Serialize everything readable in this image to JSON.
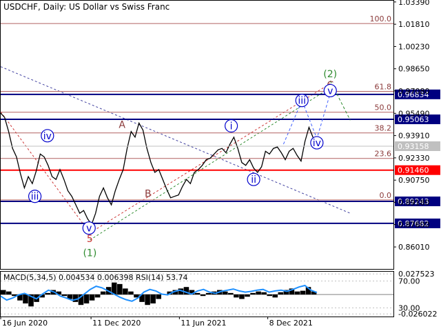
{
  "header": {
    "symbol": "USDCHF, Daily:",
    "description": "US Dollar vs Swiss Franc"
  },
  "chart_data": {
    "type": "line",
    "main": {
      "ylim": [
        0.8445,
        1.0348
      ],
      "y_ticks": [
        "1.03390",
        "1.01810",
        "1.00230",
        "0.98650",
        "0.97080",
        "0.95490",
        "0.93910",
        "0.92330",
        "0.90750",
        "0.89180",
        "0.87600",
        "0.86010"
      ],
      "x_ticks": [
        "16 Jun 2020",
        "11 Dec 2020",
        "11 Jun 2021",
        "8 Dec 2021"
      ],
      "price_label": "0.93158",
      "price_close": 0.93158,
      "price_series": [
        0.955,
        0.952,
        0.942,
        0.93,
        0.924,
        0.912,
        0.902,
        0.91,
        0.905,
        0.914,
        0.926,
        0.924,
        0.918,
        0.91,
        0.908,
        0.915,
        0.908,
        0.9,
        0.896,
        0.89,
        0.884,
        0.886,
        0.88,
        0.876,
        0.884,
        0.896,
        0.902,
        0.895,
        0.89,
        0.9,
        0.908,
        0.915,
        0.93,
        0.942,
        0.938,
        0.948,
        0.943,
        0.93,
        0.92,
        0.913,
        0.915,
        0.908,
        0.901,
        0.895,
        0.896,
        0.897,
        0.903,
        0.908,
        0.905,
        0.913,
        0.915,
        0.918,
        0.922,
        0.923,
        0.926,
        0.929,
        0.93,
        0.927,
        0.933,
        0.938,
        0.93,
        0.92,
        0.918,
        0.922,
        0.916,
        0.913,
        0.917,
        0.928,
        0.926,
        0.93,
        0.931,
        0.927,
        0.922,
        0.928,
        0.93,
        0.925,
        0.921,
        0.935,
        0.945,
        0.938,
        0.932
      ],
      "fib_levels": [
        {
          "label": "100.0",
          "value": 1.0186
        },
        {
          "label": "61.8",
          "value": 0.9705
        },
        {
          "label": "50.0",
          "value": 0.9557
        },
        {
          "label": "38.2",
          "value": 0.941
        },
        {
          "label": "23.6",
          "value": 0.9229
        },
        {
          "label": "0.0",
          "value": 0.8935
        }
      ],
      "horizontal_levels": [
        {
          "label": "0.96834",
          "value": 0.96834,
          "color": "#000080"
        },
        {
          "label": "0.95063",
          "value": 0.95063,
          "color": "#000080"
        },
        {
          "label": "0.91460",
          "value": 0.9146,
          "color": "#ff0000"
        },
        {
          "label": "0.89243",
          "value": 0.89243,
          "color": "#000080"
        },
        {
          "label": "0.87682",
          "value": 0.87682,
          "color": "#000080"
        }
      ],
      "wave_labels": [
        {
          "label": "A",
          "color": "#8b3a3a",
          "circled": false,
          "x": 0.309,
          "y": 0.9471
        },
        {
          "label": "B",
          "color": "#8b3a3a",
          "circled": false,
          "x": 0.375,
          "y": 0.898
        },
        {
          "label": "5",
          "color": "#cc3333",
          "circled": false,
          "x": 0.227,
          "y": 0.866
        },
        {
          "label": "(1)",
          "color": "#2e8b2e",
          "circled": false,
          "x": 0.227,
          "y": 0.856
        },
        {
          "label": "(2)",
          "color": "#2e8b2e",
          "circled": false,
          "x": 0.839,
          "y": 0.983
        },
        {
          "label": "C",
          "color": "#8b3a3a",
          "circled": false,
          "x": 0.839,
          "y": 0.975
        },
        {
          "label": "iv",
          "color": "#0000cc",
          "circled": true,
          "x": 0.119,
          "y": 0.939
        },
        {
          "label": "iii",
          "color": "#0000cc",
          "circled": true,
          "x": 0.087,
          "y": 0.896
        },
        {
          "label": "v",
          "color": "#0000cc",
          "circled": true,
          "x": 0.225,
          "y": 0.8735
        },
        {
          "label": "i",
          "color": "#0000cc",
          "circled": true,
          "x": 0.587,
          "y": 0.946
        },
        {
          "label": "ii",
          "color": "#0000cc",
          "circled": true,
          "x": 0.644,
          "y": 0.908
        },
        {
          "label": "iii",
          "color": "#0000cc",
          "circled": true,
          "x": 0.767,
          "y": 0.964
        },
        {
          "label": "iv",
          "color": "#0000cc",
          "circled": true,
          "x": 0.805,
          "y": 0.934
        },
        {
          "label": "v",
          "color": "#0000cc",
          "circled": true,
          "x": 0.839,
          "y": 0.971
        }
      ],
      "projection": [
        {
          "x": 0.72,
          "y": 0.933
        },
        {
          "x": 0.767,
          "y": 0.964
        },
        {
          "x": 0.805,
          "y": 0.937
        },
        {
          "x": 0.839,
          "y": 0.969
        }
      ],
      "projection_after": [
        {
          "x": 0.839,
          "y": 0.978
        },
        {
          "x": 0.89,
          "y": 0.95
        }
      ],
      "channels": [
        {
          "color": "#4040a0",
          "from": {
            "x": 0.0,
            "y": 0.988
          },
          "to": {
            "x": 0.89,
            "y": 0.884
          }
        },
        {
          "color": "#2e8b2e",
          "from": {
            "x": 0.227,
            "y": 0.865
          },
          "to": {
            "x": 0.839,
            "y": 0.973
          }
        },
        {
          "color": "#cc3333",
          "from": {
            "x": 0.227,
            "y": 0.87
          },
          "to": {
            "x": 0.839,
            "y": 0.976
          }
        },
        {
          "color": "#cc3333",
          "from": {
            "x": 0.0,
            "y": 0.956
          },
          "to": {
            "x": 0.227,
            "y": 0.87
          }
        }
      ]
    },
    "indicator": {
      "title": "MACD(5,34,5) 0.004534 0.006398 RSI(14) 53.74",
      "ylim": [
        -0.0295,
        0.0305
      ],
      "y_ticks": [
        {
          "label": "0.027523",
          "value": 0.027523
        },
        {
          "label": "70.00",
          "value": 0.018
        },
        {
          "label": "30.00",
          "value": -0.018
        },
        {
          "label": "-0.026022",
          "value": -0.026022
        }
      ],
      "macd_hist": [
        0.006,
        0.004,
        -0.002,
        -0.008,
        -0.012,
        -0.016,
        -0.01,
        -0.004,
        0.002,
        0.006,
        0.004,
        -0.002,
        -0.006,
        -0.01,
        -0.014,
        -0.012,
        -0.008,
        -0.004,
        0.004,
        0.01,
        0.016,
        0.014,
        0.008,
        0.004,
        -0.004,
        -0.01,
        -0.014,
        -0.012,
        -0.006,
        0.0,
        0.004,
        0.006,
        0.008,
        0.01,
        0.006,
        0.002,
        -0.002,
        0.002,
        0.004,
        0.006,
        0.004,
        0.002,
        -0.004,
        -0.006,
        -0.003,
        0.002,
        0.004,
        0.003,
        -0.002,
        -0.004,
        0.003,
        0.006,
        0.008,
        0.004,
        0.005,
        0.01,
        0.004
      ],
      "rsi": [
        45,
        35,
        40,
        48,
        52,
        45,
        38,
        50,
        60,
        55,
        45,
        40,
        34,
        38,
        50,
        62,
        70,
        66,
        58,
        50,
        42,
        36,
        32,
        40,
        55,
        62,
        58,
        50,
        48,
        56,
        60,
        55,
        50,
        58,
        62,
        55,
        52,
        57,
        60,
        63,
        58,
        55,
        57,
        60,
        62,
        55,
        58,
        60,
        57,
        62,
        68,
        72,
        60,
        54
      ]
    }
  }
}
